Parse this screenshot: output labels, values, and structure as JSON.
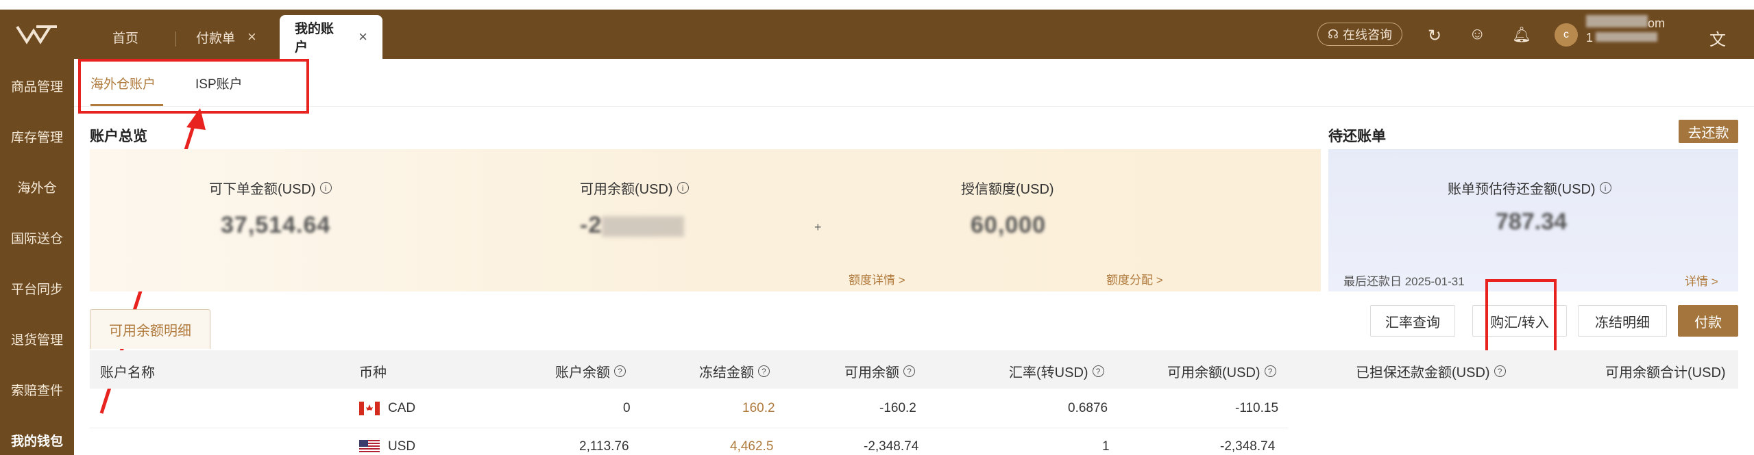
{
  "topbar": {
    "tabs": [
      {
        "label": "首页"
      },
      {
        "label": "付款单",
        "close": "×"
      },
      {
        "label": "我的账户",
        "close": "×"
      }
    ],
    "consult_label": "在线咨询",
    "avatar_letter": "c",
    "user_suffix": "om",
    "user_line2": "1"
  },
  "sidebar": {
    "items": [
      "商品管理",
      "库存管理",
      "海外仓",
      "国际送仓",
      "平台同步",
      "退货管理",
      "索赔查件",
      "我的钱包"
    ]
  },
  "subtabs": [
    "海外仓账户",
    "ISP账户"
  ],
  "overview": {
    "title": "账户总览",
    "orderable_label": "可下单金额(USD)",
    "orderable_value": "37,514.64",
    "available_label": "可用余额(USD)",
    "available_value": "-2",
    "credit_label": "授信额度(USD)",
    "credit_value": "60,000",
    "plus": "+",
    "quota_detail": "额度详情 >",
    "quota_alloc": "额度分配 >"
  },
  "bill": {
    "title": "待还账单",
    "repay_button": "去还款",
    "estimate_label": "账单预估待还金额(USD)",
    "estimate_value": "787.34",
    "last_repay": "最后还款日 2025-01-31",
    "detail_link": "详情 >"
  },
  "detail": {
    "tab_label": "可用余额明细",
    "buttons": {
      "rate_query": "汇率查询",
      "exchange": "购汇/转入",
      "freeze": "冻结明细",
      "pay": "付款"
    },
    "columns": [
      "账户名称",
      "币种",
      "账户余额",
      "冻结金额",
      "可用余额",
      "汇率(转USD)",
      "可用余额(USD)",
      "已担保还款金额(USD)",
      "可用余额合计(USD)"
    ],
    "rows": [
      {
        "currency": "CAD",
        "balance": "0",
        "frozen": "160.2",
        "available": "-160.2",
        "rate": "0.6876",
        "available_usd": "-110.15"
      },
      {
        "currency": "USD",
        "balance": "2,113.76",
        "frozen": "4,462.5",
        "available": "-2,348.74",
        "rate": "1",
        "available_usd": "-2,348.74"
      }
    ]
  },
  "colors": {
    "brand_brown": "#6e4a20",
    "accent": "#a4763d",
    "highlight_red": "#e8231f"
  }
}
